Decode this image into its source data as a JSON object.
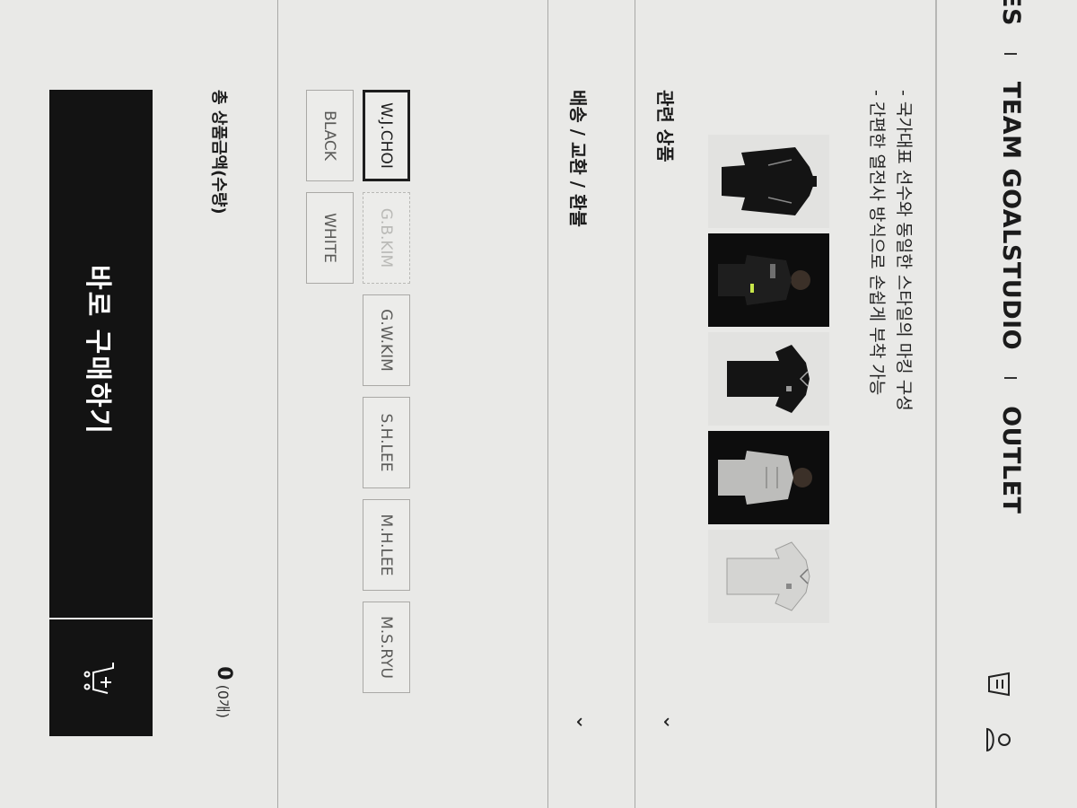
{
  "nav": {
    "items": [
      "ES",
      "TEAM GOALSTUDIO",
      "OUTLET"
    ]
  },
  "header_icons": [
    "cart-list-icon",
    "user-icon"
  ],
  "features": [
    "- 국가대표 선수와 동일한 스타일의 마킹 구성",
    "- 간편한 열전사 방식으로 손쉽게 부착 가능"
  ],
  "thumbnails": [
    {
      "name": "black-jacket",
      "bg": "light"
    },
    {
      "name": "model-black-jersey",
      "bg": "dark"
    },
    {
      "name": "black-jersey",
      "bg": "light"
    },
    {
      "name": "model-white-jersey",
      "bg": "dark"
    },
    {
      "name": "white-jersey",
      "bg": "light"
    }
  ],
  "sections": {
    "related": "관련 상품",
    "shipping": "배송 / 교환 / 환불"
  },
  "options": {
    "row1": [
      "W.J.CHOI",
      "G.B.KIM",
      "G.W.KIM",
      "S.H.LEE",
      "M.H.LEE",
      "M.S.RYU"
    ],
    "row2": [
      "BLACK",
      "WHITE"
    ],
    "selected": "W.J.CHOI",
    "soldout": [
      "G.B.KIM"
    ]
  },
  "total": {
    "label": "총 상품금액(수량)",
    "qty": "0",
    "unit": "(0개)"
  },
  "buy": {
    "label": "바로 구매하기"
  },
  "colors": {
    "button_bg": "#131313",
    "page_bg": "#e9e9e7"
  }
}
